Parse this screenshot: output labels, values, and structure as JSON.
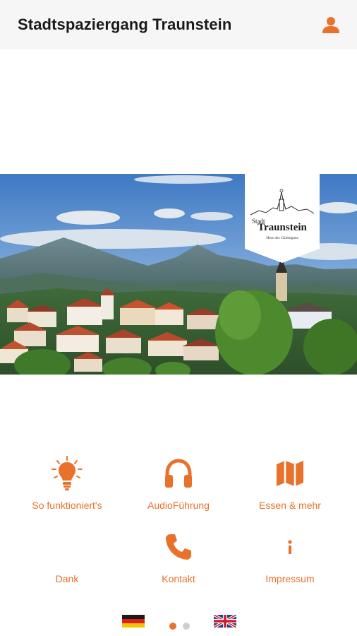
{
  "header": {
    "title": "Stadtspaziergang Traunstein",
    "user_icon": "user-icon"
  },
  "hero": {
    "logo_small": "Stadt",
    "logo_main": "Traunstein",
    "logo_sub": "Herz des Chiemgaus"
  },
  "menu": {
    "items": [
      {
        "label": "So funktioniert's",
        "icon": "lightbulb-icon"
      },
      {
        "label": "AudioFührung",
        "icon": "headphones-icon"
      },
      {
        "label": "Essen & mehr",
        "icon": "map-icon"
      },
      {
        "label": "Dank",
        "icon": "none"
      },
      {
        "label": "Kontakt",
        "icon": "phone-icon"
      },
      {
        "label": "Impressum",
        "icon": "info-icon"
      }
    ]
  },
  "pager": {
    "pages": 2,
    "current": 1
  },
  "languages": [
    "de",
    "en"
  ],
  "colors": {
    "accent": "#e8722b",
    "header_bg": "#f6f6f6",
    "text": "#1a1a1a"
  }
}
